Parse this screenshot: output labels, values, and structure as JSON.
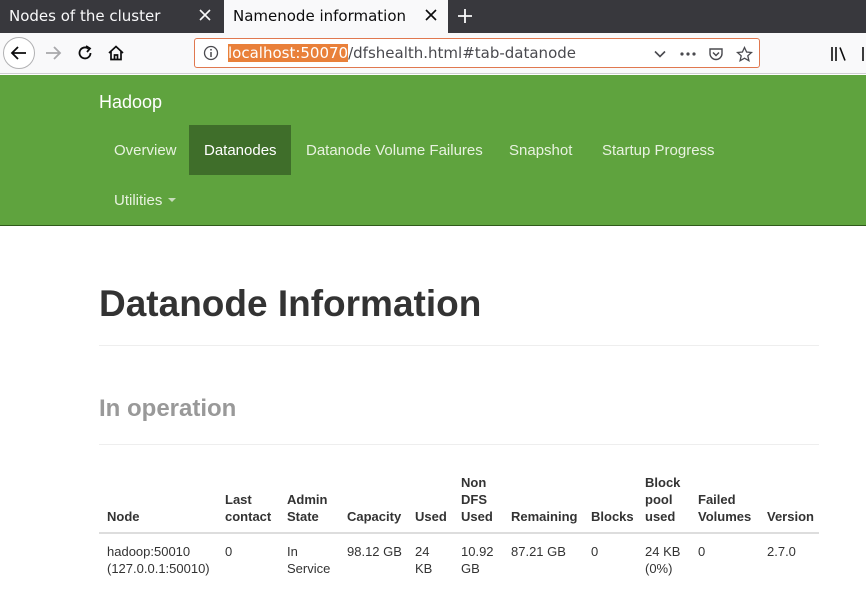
{
  "browser": {
    "tabs": [
      {
        "title": "Nodes of the cluster",
        "active": false
      },
      {
        "title": "Namenode information",
        "active": true
      }
    ],
    "url": {
      "host": "localhost:50070",
      "path": "/dfshealth.html#tab-datanode"
    },
    "icons": {
      "back": "back-arrow-icon",
      "forward": "forward-arrow-icon",
      "reload": "reload-icon",
      "home": "home-icon",
      "info": "info-icon",
      "dropdown": "chevron-down-icon",
      "more": "ellipsis-icon",
      "pocket": "pocket-icon",
      "bookmark": "star-icon",
      "library": "library-icon",
      "sidebar": "sidebar-icon",
      "close": "close-icon",
      "new_tab": "plus-icon"
    },
    "colors": {
      "tab_strip": "#38383d",
      "url_highlight": "#e9803a"
    }
  },
  "hadoop_nav": {
    "brand": "Hadoop",
    "items": [
      {
        "label": "Overview",
        "active": false
      },
      {
        "label": "Datanodes",
        "active": true
      },
      {
        "label": "Datanode Volume Failures",
        "active": false
      },
      {
        "label": "Snapshot",
        "active": false
      },
      {
        "label": "Startup Progress",
        "active": false
      },
      {
        "label": "Utilities",
        "active": false,
        "dropdown": true
      }
    ],
    "colors": {
      "background": "#5fa33e",
      "active": "#3f6e2a"
    }
  },
  "page": {
    "title": "Datanode Information",
    "section": "In operation"
  },
  "table": {
    "headers": [
      [
        "Node"
      ],
      [
        "Last",
        "contact"
      ],
      [
        "Admin",
        "State"
      ],
      [
        "Capacity"
      ],
      [
        "Used"
      ],
      [
        "Non",
        "DFS",
        "Used"
      ],
      [
        "Remaining"
      ],
      [
        "Blocks"
      ],
      [
        "Block",
        "pool",
        "used"
      ],
      [
        "Failed",
        "Volumes"
      ],
      [
        "Version"
      ]
    ],
    "rows": [
      [
        [
          "hadoop:50010",
          "(127.0.0.1:50010)"
        ],
        [
          "0"
        ],
        [
          "In",
          "Service"
        ],
        [
          "98.12 GB"
        ],
        [
          "24",
          "KB"
        ],
        [
          "10.92",
          "GB"
        ],
        [
          "87.21 GB"
        ],
        [
          "0"
        ],
        [
          "24 KB",
          "(0%)"
        ],
        [
          "0"
        ],
        [
          "2.7.0"
        ]
      ]
    ]
  }
}
